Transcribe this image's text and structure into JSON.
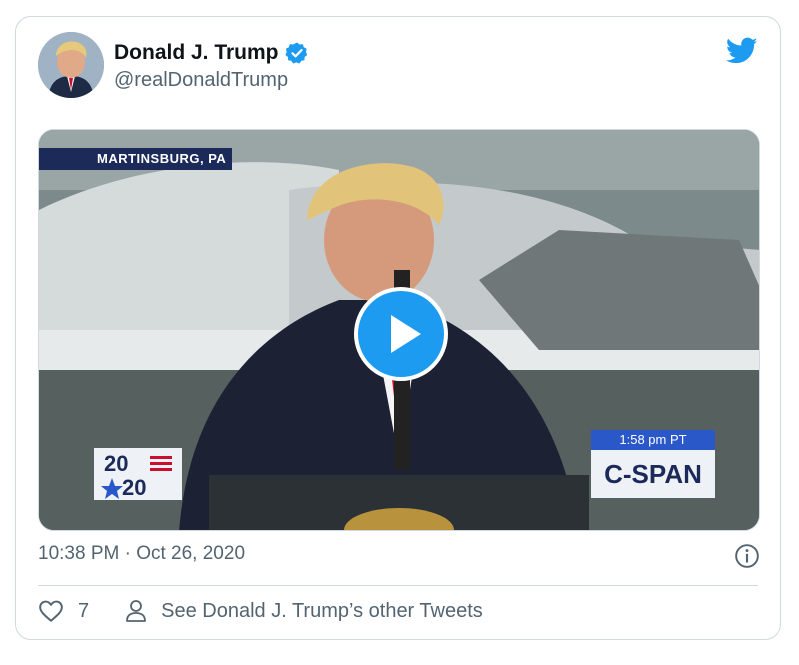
{
  "tweet": {
    "author": {
      "name": "Donald J. Trump",
      "handle": "@realDonaldTrump",
      "verified": true
    },
    "video": {
      "location_badge": "MARTINSBURG, PA",
      "time_badge": "1:58 pm PT",
      "network_badge": "C-SPAN",
      "logo_top": "20",
      "logo_bottom": "20"
    },
    "timestamp": "10:38 PM · Oct 26, 2020",
    "actions": {
      "like_count": "7",
      "see_more": "See Donald J. Trump’s other Tweets"
    }
  },
  "colors": {
    "twitter_blue": "#1d9bf0",
    "text_primary": "#0f1419",
    "text_secondary": "#536471",
    "border": "#cfd9de"
  },
  "icons": [
    "verified-badge-icon",
    "twitter-bird-icon",
    "play-icon",
    "info-icon",
    "heart-icon",
    "person-icon"
  ]
}
